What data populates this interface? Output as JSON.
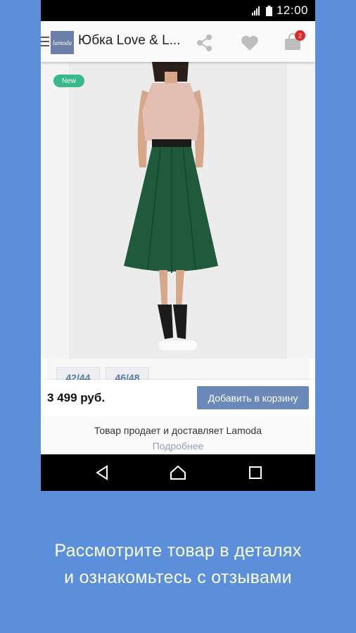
{
  "status_bar": {
    "time": "12:00"
  },
  "app_bar": {
    "logo_text": "lamoda",
    "title": "Юбка Love & L...",
    "cart_count": "2"
  },
  "product": {
    "badge": "New",
    "sizes": [
      "42/44",
      "46/48"
    ],
    "price": "3 499 руб.",
    "add_to_cart_label": "Добавить в корзину",
    "seller_text": "Товар продает и доставляет Lamoda",
    "more_link": "Подробнее"
  },
  "caption": {
    "line1": "Рассмотрите товар в деталях",
    "line2": "и ознакомьтесь с отзывами"
  },
  "colors": {
    "background": "#5b8fd9",
    "accent_button": "#6b89b8",
    "badge_new": "#39b98a",
    "cart_badge": "#e0262b"
  }
}
